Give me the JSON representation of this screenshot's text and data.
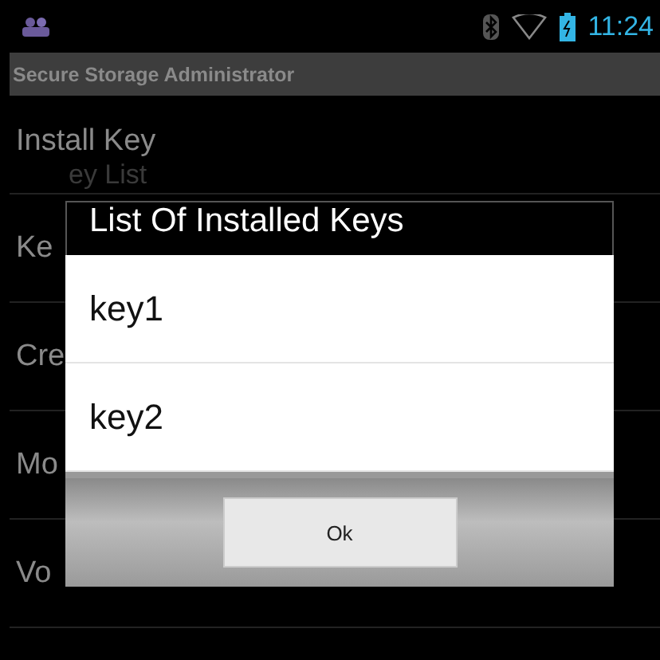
{
  "status_bar": {
    "time": "11:24"
  },
  "action_bar": {
    "title": "Secure Storage Administrator"
  },
  "menu_items": [
    {
      "title": "Install Key",
      "subtitle": "ey List"
    },
    {
      "title": "Ke"
    },
    {
      "title": "Cre"
    },
    {
      "title": "Mo"
    },
    {
      "title": "Vo"
    }
  ],
  "dialog": {
    "title": "List Of Installed Keys",
    "items": [
      "key1",
      "key2"
    ],
    "buttons": [
      "Ok"
    ]
  }
}
